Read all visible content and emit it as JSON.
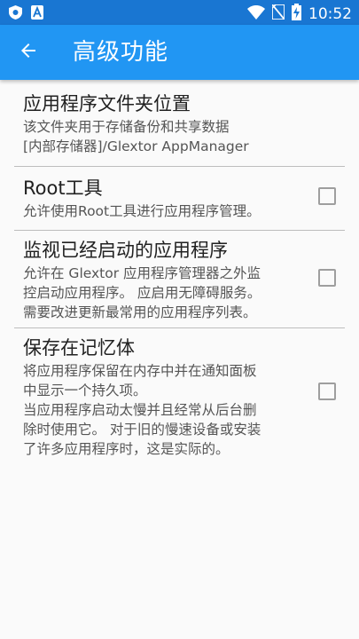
{
  "status_bar": {
    "time": "10:52",
    "icons": [
      "shield-icon",
      "a-badge-icon",
      "wifi-icon",
      "no-sim-icon",
      "battery-charging-icon"
    ]
  },
  "app_bar": {
    "title": "高级功能",
    "back_icon": "arrow-back-icon",
    "colors": {
      "app_bar": "#2196f3",
      "status_bar": "#1976d2"
    }
  },
  "preferences": [
    {
      "title": "应用程序文件夹位置",
      "summary_lines": [
        "该文件夹用于存储备份和共享数据",
        "[内部存储器]/Glextor AppManager"
      ],
      "has_checkbox": false
    },
    {
      "title": "Root工具",
      "summary_lines": [
        "允许使用Root工具进行应用程序管理。"
      ],
      "has_checkbox": true,
      "checked": false
    },
    {
      "title": "监视已经启动的应用程序",
      "summary_lines": [
        "允许在 Glextor 应用程序管理器之外监",
        "控启动应用程序。 应启用无障碍服务。",
        "需要改进更新最常用的应用程序列表。"
      ],
      "has_checkbox": true,
      "checked": false
    },
    {
      "title": "保存在记忆体",
      "summary_lines": [
        "将应用程序保留在内存中并在通知面板",
        "中显示一个持久项。",
        "当应用程序启动太慢并且经常从后台删",
        "除时使用它。 对于旧的慢速设备或安装",
        "了许多应用程序时，这是实际的。"
      ],
      "has_checkbox": true,
      "checked": false
    }
  ]
}
